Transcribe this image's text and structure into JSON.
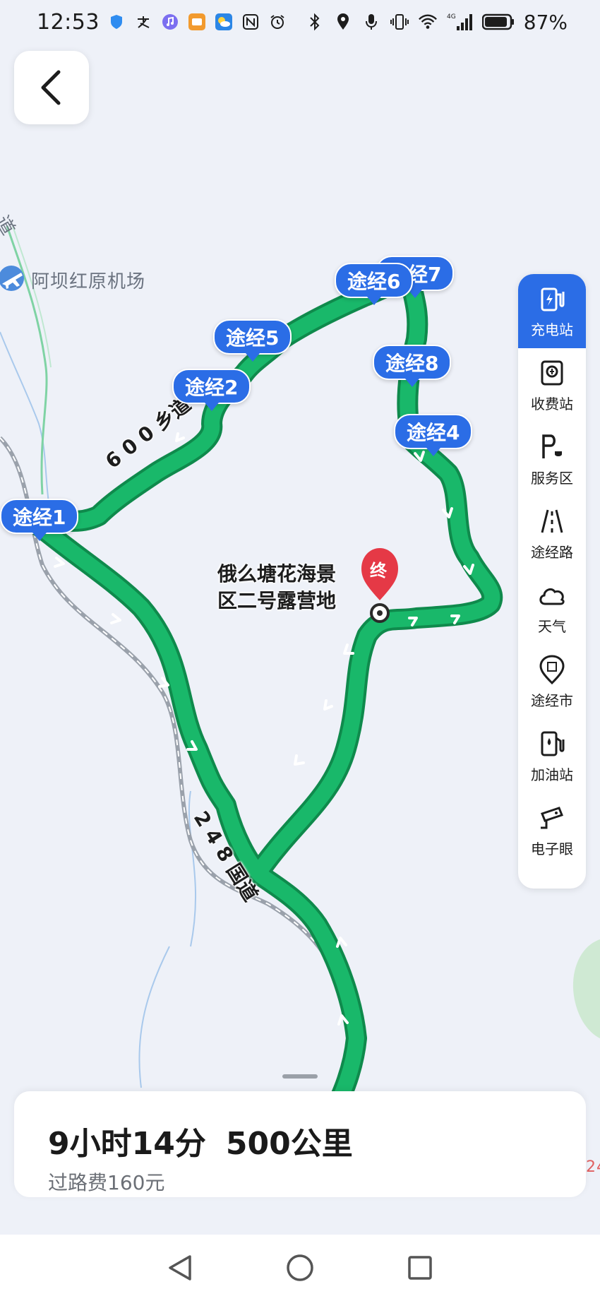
{
  "status_bar": {
    "time": "12:53",
    "battery_percent": "87%",
    "network": "4G",
    "left_icons": [
      "shield-icon",
      "alipay-icon",
      "music-icon",
      "game-app-icon",
      "weather-app-icon",
      "nfc-icon",
      "alarm-icon"
    ],
    "right_icons": [
      "bluetooth-icon",
      "location-icon",
      "mic-icon",
      "vibrate-icon",
      "wifi-icon",
      "signal-icon",
      "battery-icon"
    ]
  },
  "map": {
    "poi_airport": "阿坝红原机场",
    "road_edge_fragment": "道",
    "right_edge_fragment": "24",
    "destination_name_line1": "俄么塘花海景",
    "destination_name_line2": "区二号露营地",
    "destination_marker": "终",
    "road_600": "6 0 0 乡道",
    "road_248": "2 4 8 国道",
    "waypoints": [
      {
        "label": "途经1"
      },
      {
        "label": "途经2"
      },
      {
        "label": "途经4"
      },
      {
        "label": "途经5"
      },
      {
        "label": "途经6"
      },
      {
        "label": "途经7"
      },
      {
        "label": "途经8"
      }
    ],
    "colors": {
      "route": "#19b86a",
      "route_outline": "#0f8a4c",
      "waypoint": "#2b6de6",
      "destination": "#e53946"
    }
  },
  "toolbar": {
    "items": [
      {
        "label": "充电站",
        "icon": "charging-station-icon",
        "active": true
      },
      {
        "label": "收费站",
        "icon": "toll-station-icon",
        "active": false
      },
      {
        "label": "服务区",
        "icon": "service-area-icon",
        "active": false
      },
      {
        "label": "途经路",
        "icon": "road-icon",
        "active": false
      },
      {
        "label": "天气",
        "icon": "cloud-icon",
        "active": false
      },
      {
        "label": "途经市",
        "icon": "city-pin-icon",
        "active": false
      },
      {
        "label": "加油站",
        "icon": "gas-station-icon",
        "active": false
      },
      {
        "label": "电子眼",
        "icon": "camera-icon",
        "active": false
      }
    ]
  },
  "route_summary": {
    "duration": "9小时14分",
    "distance": "500公里",
    "toll": "过路费160元"
  }
}
